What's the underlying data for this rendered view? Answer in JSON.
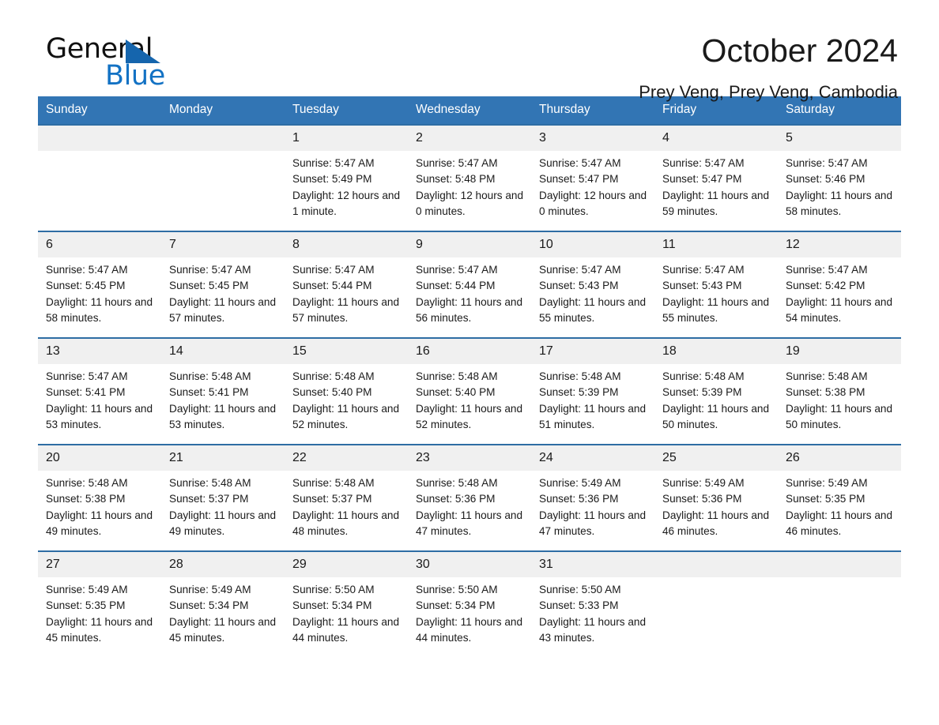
{
  "brand": {
    "name_part1": "General",
    "name_part2": "Blue",
    "triangle_color": "#1565ad",
    "blue_text_color": "#1372c4",
    "icon": "triangle-icon"
  },
  "header": {
    "title": "October 2024",
    "subtitle": "Prey Veng, Prey Veng, Cambodia"
  },
  "theme": {
    "header_bg": "#3275b4",
    "row_border": "#2e6da4",
    "daynum_bg": "#f0f0f0"
  },
  "weekdays": [
    "Sunday",
    "Monday",
    "Tuesday",
    "Wednesday",
    "Thursday",
    "Friday",
    "Saturday"
  ],
  "weeks": [
    [
      {
        "day": "",
        "blank": true
      },
      {
        "day": "",
        "blank": true
      },
      {
        "day": "1",
        "sunrise": "Sunrise: 5:47 AM",
        "sunset": "Sunset: 5:49 PM",
        "daylight": "Daylight: 12 hours and 1 minute."
      },
      {
        "day": "2",
        "sunrise": "Sunrise: 5:47 AM",
        "sunset": "Sunset: 5:48 PM",
        "daylight": "Daylight: 12 hours and 0 minutes."
      },
      {
        "day": "3",
        "sunrise": "Sunrise: 5:47 AM",
        "sunset": "Sunset: 5:47 PM",
        "daylight": "Daylight: 12 hours and 0 minutes."
      },
      {
        "day": "4",
        "sunrise": "Sunrise: 5:47 AM",
        "sunset": "Sunset: 5:47 PM",
        "daylight": "Daylight: 11 hours and 59 minutes."
      },
      {
        "day": "5",
        "sunrise": "Sunrise: 5:47 AM",
        "sunset": "Sunset: 5:46 PM",
        "daylight": "Daylight: 11 hours and 58 minutes."
      }
    ],
    [
      {
        "day": "6",
        "sunrise": "Sunrise: 5:47 AM",
        "sunset": "Sunset: 5:45 PM",
        "daylight": "Daylight: 11 hours and 58 minutes."
      },
      {
        "day": "7",
        "sunrise": "Sunrise: 5:47 AM",
        "sunset": "Sunset: 5:45 PM",
        "daylight": "Daylight: 11 hours and 57 minutes."
      },
      {
        "day": "8",
        "sunrise": "Sunrise: 5:47 AM",
        "sunset": "Sunset: 5:44 PM",
        "daylight": "Daylight: 11 hours and 57 minutes."
      },
      {
        "day": "9",
        "sunrise": "Sunrise: 5:47 AM",
        "sunset": "Sunset: 5:44 PM",
        "daylight": "Daylight: 11 hours and 56 minutes."
      },
      {
        "day": "10",
        "sunrise": "Sunrise: 5:47 AM",
        "sunset": "Sunset: 5:43 PM",
        "daylight": "Daylight: 11 hours and 55 minutes."
      },
      {
        "day": "11",
        "sunrise": "Sunrise: 5:47 AM",
        "sunset": "Sunset: 5:43 PM",
        "daylight": "Daylight: 11 hours and 55 minutes."
      },
      {
        "day": "12",
        "sunrise": "Sunrise: 5:47 AM",
        "sunset": "Sunset: 5:42 PM",
        "daylight": "Daylight: 11 hours and 54 minutes."
      }
    ],
    [
      {
        "day": "13",
        "sunrise": "Sunrise: 5:47 AM",
        "sunset": "Sunset: 5:41 PM",
        "daylight": "Daylight: 11 hours and 53 minutes."
      },
      {
        "day": "14",
        "sunrise": "Sunrise: 5:48 AM",
        "sunset": "Sunset: 5:41 PM",
        "daylight": "Daylight: 11 hours and 53 minutes."
      },
      {
        "day": "15",
        "sunrise": "Sunrise: 5:48 AM",
        "sunset": "Sunset: 5:40 PM",
        "daylight": "Daylight: 11 hours and 52 minutes."
      },
      {
        "day": "16",
        "sunrise": "Sunrise: 5:48 AM",
        "sunset": "Sunset: 5:40 PM",
        "daylight": "Daylight: 11 hours and 52 minutes."
      },
      {
        "day": "17",
        "sunrise": "Sunrise: 5:48 AM",
        "sunset": "Sunset: 5:39 PM",
        "daylight": "Daylight: 11 hours and 51 minutes."
      },
      {
        "day": "18",
        "sunrise": "Sunrise: 5:48 AM",
        "sunset": "Sunset: 5:39 PM",
        "daylight": "Daylight: 11 hours and 50 minutes."
      },
      {
        "day": "19",
        "sunrise": "Sunrise: 5:48 AM",
        "sunset": "Sunset: 5:38 PM",
        "daylight": "Daylight: 11 hours and 50 minutes."
      }
    ],
    [
      {
        "day": "20",
        "sunrise": "Sunrise: 5:48 AM",
        "sunset": "Sunset: 5:38 PM",
        "daylight": "Daylight: 11 hours and 49 minutes."
      },
      {
        "day": "21",
        "sunrise": "Sunrise: 5:48 AM",
        "sunset": "Sunset: 5:37 PM",
        "daylight": "Daylight: 11 hours and 49 minutes."
      },
      {
        "day": "22",
        "sunrise": "Sunrise: 5:48 AM",
        "sunset": "Sunset: 5:37 PM",
        "daylight": "Daylight: 11 hours and 48 minutes."
      },
      {
        "day": "23",
        "sunrise": "Sunrise: 5:48 AM",
        "sunset": "Sunset: 5:36 PM",
        "daylight": "Daylight: 11 hours and 47 minutes."
      },
      {
        "day": "24",
        "sunrise": "Sunrise: 5:49 AM",
        "sunset": "Sunset: 5:36 PM",
        "daylight": "Daylight: 11 hours and 47 minutes."
      },
      {
        "day": "25",
        "sunrise": "Sunrise: 5:49 AM",
        "sunset": "Sunset: 5:36 PM",
        "daylight": "Daylight: 11 hours and 46 minutes."
      },
      {
        "day": "26",
        "sunrise": "Sunrise: 5:49 AM",
        "sunset": "Sunset: 5:35 PM",
        "daylight": "Daylight: 11 hours and 46 minutes."
      }
    ],
    [
      {
        "day": "27",
        "sunrise": "Sunrise: 5:49 AM",
        "sunset": "Sunset: 5:35 PM",
        "daylight": "Daylight: 11 hours and 45 minutes."
      },
      {
        "day": "28",
        "sunrise": "Sunrise: 5:49 AM",
        "sunset": "Sunset: 5:34 PM",
        "daylight": "Daylight: 11 hours and 45 minutes."
      },
      {
        "day": "29",
        "sunrise": "Sunrise: 5:50 AM",
        "sunset": "Sunset: 5:34 PM",
        "daylight": "Daylight: 11 hours and 44 minutes."
      },
      {
        "day": "30",
        "sunrise": "Sunrise: 5:50 AM",
        "sunset": "Sunset: 5:34 PM",
        "daylight": "Daylight: 11 hours and 44 minutes."
      },
      {
        "day": "31",
        "sunrise": "Sunrise: 5:50 AM",
        "sunset": "Sunset: 5:33 PM",
        "daylight": "Daylight: 11 hours and 43 minutes."
      },
      {
        "day": "",
        "blank": true
      },
      {
        "day": "",
        "blank": true
      }
    ]
  ]
}
